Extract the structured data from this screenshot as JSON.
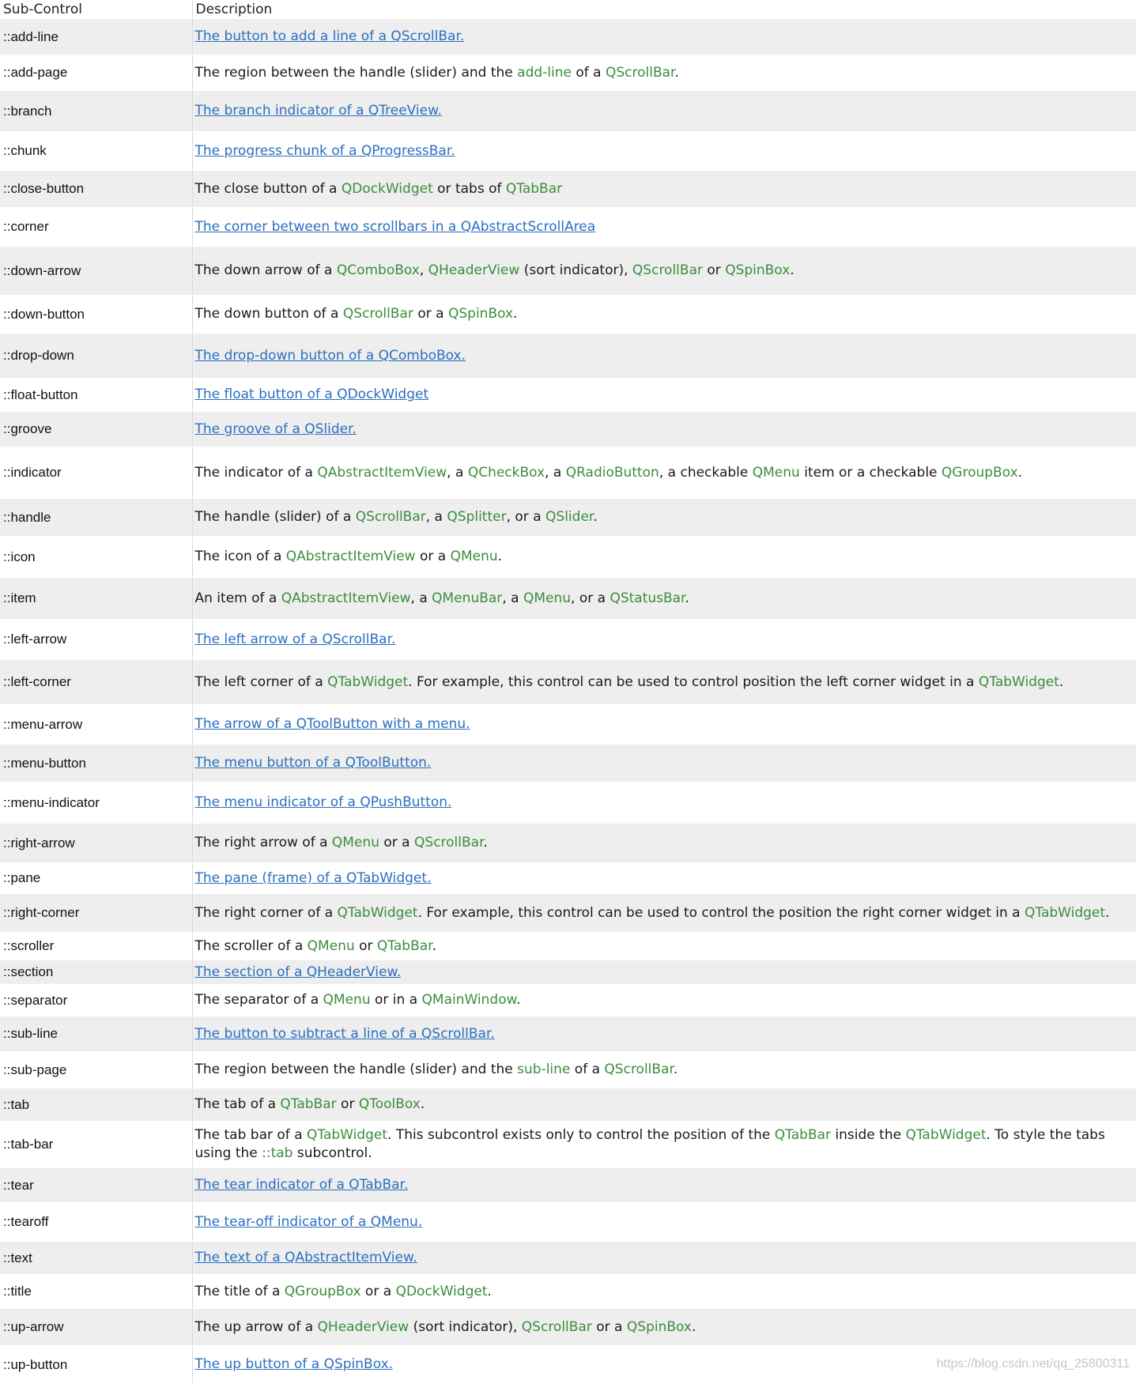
{
  "header": {
    "col1": "Sub-Control",
    "col2": "Description"
  },
  "rows": [
    {
      "name": "::add-line",
      "desc": [
        {
          "t": "The button to add a line of a QScrollBar.",
          "k": "link"
        }
      ]
    },
    {
      "name": "::add-page",
      "desc": [
        {
          "t": "The region between the handle (slider) and the ",
          "k": "text"
        },
        {
          "t": "add-line",
          "k": "ref"
        },
        {
          "t": " of a ",
          "k": "text"
        },
        {
          "t": "QScrollBar",
          "k": "ref"
        },
        {
          "t": ".",
          "k": "text"
        }
      ]
    },
    {
      "name": "::branch",
      "desc": [
        {
          "t": "The branch indicator of a QTreeView.",
          "k": "link"
        }
      ]
    },
    {
      "name": "::chunk",
      "desc": [
        {
          "t": "The progress chunk of a QProgressBar.",
          "k": "link"
        }
      ]
    },
    {
      "name": "::close-button",
      "desc": [
        {
          "t": "The close button of a ",
          "k": "text"
        },
        {
          "t": "QDockWidget",
          "k": "ref"
        },
        {
          "t": " or tabs of ",
          "k": "text"
        },
        {
          "t": "QTabBar",
          "k": "ref"
        }
      ]
    },
    {
      "name": "::corner",
      "desc": [
        {
          "t": "The corner between two scrollbars in a QAbstractScrollArea",
          "k": "link"
        }
      ]
    },
    {
      "name": "::down-arrow",
      "desc": [
        {
          "t": "The down arrow of a ",
          "k": "text"
        },
        {
          "t": "QComboBox",
          "k": "ref"
        },
        {
          "t": ", ",
          "k": "text"
        },
        {
          "t": "QHeaderView",
          "k": "ref"
        },
        {
          "t": " (sort indicator), ",
          "k": "text"
        },
        {
          "t": "QScrollBar",
          "k": "ref"
        },
        {
          "t": " or ",
          "k": "text"
        },
        {
          "t": "QSpinBox",
          "k": "ref"
        },
        {
          "t": ".",
          "k": "text"
        }
      ]
    },
    {
      "name": "::down-button",
      "desc": [
        {
          "t": "The down button of a ",
          "k": "text"
        },
        {
          "t": "QScrollBar",
          "k": "ref"
        },
        {
          "t": " or a ",
          "k": "text"
        },
        {
          "t": "QSpinBox",
          "k": "ref"
        },
        {
          "t": ".",
          "k": "text"
        }
      ]
    },
    {
      "name": "::drop-down",
      "desc": [
        {
          "t": "The drop-down button of a QComboBox.",
          "k": "link"
        }
      ]
    },
    {
      "name": "::float-button",
      "desc": [
        {
          "t": "The float button of a QDockWidget",
          "k": "link"
        }
      ]
    },
    {
      "name": "::groove",
      "desc": [
        {
          "t": "The groove of a QSlider.",
          "k": "link"
        }
      ]
    },
    {
      "name": "::indicator",
      "desc": [
        {
          "t": "The indicator of a ",
          "k": "text"
        },
        {
          "t": "QAbstractItemView",
          "k": "ref"
        },
        {
          "t": ", a ",
          "k": "text"
        },
        {
          "t": "QCheckBox",
          "k": "ref"
        },
        {
          "t": ", a ",
          "k": "text"
        },
        {
          "t": "QRadioButton",
          "k": "ref"
        },
        {
          "t": ", a checkable ",
          "k": "text"
        },
        {
          "t": "QMenu",
          "k": "ref"
        },
        {
          "t": " item or a checkable ",
          "k": "text"
        },
        {
          "t": "QGroupBox",
          "k": "ref"
        },
        {
          "t": ".",
          "k": "text"
        }
      ]
    },
    {
      "name": "::handle",
      "desc": [
        {
          "t": "The handle (slider) of a ",
          "k": "text"
        },
        {
          "t": "QScrollBar",
          "k": "ref"
        },
        {
          "t": ", a ",
          "k": "text"
        },
        {
          "t": "QSplitter",
          "k": "ref"
        },
        {
          "t": ", or a ",
          "k": "text"
        },
        {
          "t": "QSlider",
          "k": "ref"
        },
        {
          "t": ".",
          "k": "text"
        }
      ]
    },
    {
      "name": "::icon",
      "desc": [
        {
          "t": "The icon of a ",
          "k": "text"
        },
        {
          "t": "QAbstractItemView",
          "k": "ref"
        },
        {
          "t": " or a ",
          "k": "text"
        },
        {
          "t": "QMenu",
          "k": "ref"
        },
        {
          "t": ".",
          "k": "text"
        }
      ]
    },
    {
      "name": "::item",
      "desc": [
        {
          "t": "An item of a ",
          "k": "text"
        },
        {
          "t": "QAbstractItemView",
          "k": "ref"
        },
        {
          "t": ", a ",
          "k": "text"
        },
        {
          "t": "QMenuBar",
          "k": "ref"
        },
        {
          "t": ", a ",
          "k": "text"
        },
        {
          "t": "QMenu",
          "k": "ref"
        },
        {
          "t": ", or a ",
          "k": "text"
        },
        {
          "t": "QStatusBar",
          "k": "ref"
        },
        {
          "t": ".",
          "k": "text"
        }
      ]
    },
    {
      "name": "::left-arrow",
      "desc": [
        {
          "t": "The left arrow of a QScrollBar.",
          "k": "link"
        }
      ]
    },
    {
      "name": "::left-corner",
      "desc": [
        {
          "t": "The left corner of a ",
          "k": "text"
        },
        {
          "t": "QTabWidget",
          "k": "ref"
        },
        {
          "t": ". For example, this control can be used to control position the left corner widget in a ",
          "k": "text"
        },
        {
          "t": "QTabWidget",
          "k": "ref"
        },
        {
          "t": ".",
          "k": "text"
        }
      ]
    },
    {
      "name": "::menu-arrow",
      "desc": [
        {
          "t": "The arrow of a QToolButton with a menu.",
          "k": "link"
        }
      ]
    },
    {
      "name": "::menu-button",
      "desc": [
        {
          "t": "The menu button of a QToolButton.",
          "k": "link"
        }
      ]
    },
    {
      "name": "::menu-indicator",
      "desc": [
        {
          "t": "The menu indicator of a QPushButton.",
          "k": "link"
        }
      ]
    },
    {
      "name": "::right-arrow",
      "desc": [
        {
          "t": "The right arrow of a ",
          "k": "text"
        },
        {
          "t": "QMenu",
          "k": "ref"
        },
        {
          "t": " or a ",
          "k": "text"
        },
        {
          "t": "QScrollBar",
          "k": "ref"
        },
        {
          "t": ".",
          "k": "text"
        }
      ]
    },
    {
      "name": "::pane",
      "desc": [
        {
          "t": "The pane (frame) of a QTabWidget.",
          "k": "link"
        }
      ]
    },
    {
      "name": "::right-corner",
      "desc": [
        {
          "t": "The right corner of a ",
          "k": "text"
        },
        {
          "t": "QTabWidget",
          "k": "ref"
        },
        {
          "t": ". For example, this control can be used to control the position the right corner widget in a ",
          "k": "text"
        },
        {
          "t": "QTabWidget",
          "k": "ref"
        },
        {
          "t": ".",
          "k": "text"
        }
      ]
    },
    {
      "name": "::scroller",
      "desc": [
        {
          "t": "The scroller of a ",
          "k": "text"
        },
        {
          "t": "QMenu",
          "k": "ref"
        },
        {
          "t": " or ",
          "k": "text"
        },
        {
          "t": "QTabBar",
          "k": "ref"
        },
        {
          "t": ".",
          "k": "text"
        }
      ]
    },
    {
      "name": "::section",
      "desc": [
        {
          "t": "The section of a QHeaderView.",
          "k": "link"
        }
      ]
    },
    {
      "name": "::separator",
      "desc": [
        {
          "t": "The separator of a ",
          "k": "text"
        },
        {
          "t": "QMenu",
          "k": "ref"
        },
        {
          "t": " or in a ",
          "k": "text"
        },
        {
          "t": "QMainWindow",
          "k": "ref"
        },
        {
          "t": ".",
          "k": "text"
        }
      ]
    },
    {
      "name": "::sub-line",
      "desc": [
        {
          "t": "The button to subtract a line of a QScrollBar.",
          "k": "link"
        }
      ]
    },
    {
      "name": "::sub-page",
      "desc": [
        {
          "t": "The region between the handle (slider) and the ",
          "k": "text"
        },
        {
          "t": "sub-line",
          "k": "ref"
        },
        {
          "t": " of a ",
          "k": "text"
        },
        {
          "t": "QScrollBar",
          "k": "ref"
        },
        {
          "t": ".",
          "k": "text"
        }
      ]
    },
    {
      "name": "::tab",
      "desc": [
        {
          "t": "The tab of a ",
          "k": "text"
        },
        {
          "t": "QTabBar",
          "k": "ref"
        },
        {
          "t": " or ",
          "k": "text"
        },
        {
          "t": "QToolBox",
          "k": "ref"
        },
        {
          "t": ".",
          "k": "text"
        }
      ]
    },
    {
      "name": "::tab-bar",
      "desc": [
        {
          "t": "The tab bar of a ",
          "k": "text"
        },
        {
          "t": "QTabWidget",
          "k": "ref"
        },
        {
          "t": ". This subcontrol exists only to control the position of the ",
          "k": "text"
        },
        {
          "t": "QTabBar",
          "k": "ref"
        },
        {
          "t": " inside the ",
          "k": "text"
        },
        {
          "t": "QTabWidget",
          "k": "ref"
        },
        {
          "t": ". To style the tabs using the ",
          "k": "text"
        },
        {
          "t": "::tab",
          "k": "ref"
        },
        {
          "t": " subcontrol.",
          "k": "text"
        }
      ]
    },
    {
      "name": "::tear",
      "desc": [
        {
          "t": "The tear indicator of a QTabBar.",
          "k": "link"
        }
      ]
    },
    {
      "name": "::tearoff",
      "desc": [
        {
          "t": "The tear-off indicator of a QMenu.",
          "k": "link"
        }
      ]
    },
    {
      "name": "::text",
      "desc": [
        {
          "t": "The text of a QAbstractItemView.",
          "k": "link"
        }
      ]
    },
    {
      "name": "::title",
      "desc": [
        {
          "t": "The title of a ",
          "k": "text"
        },
        {
          "t": "QGroupBox",
          "k": "ref"
        },
        {
          "t": " or a ",
          "k": "text"
        },
        {
          "t": "QDockWidget",
          "k": "ref"
        },
        {
          "t": ".",
          "k": "text"
        }
      ]
    },
    {
      "name": "::up-arrow",
      "desc": [
        {
          "t": "The up arrow of a ",
          "k": "text"
        },
        {
          "t": "QHeaderView",
          "k": "ref"
        },
        {
          "t": " (sort indicator), ",
          "k": "text"
        },
        {
          "t": "QScrollBar",
          "k": "ref"
        },
        {
          "t": " or a ",
          "k": "text"
        },
        {
          "t": "QSpinBox",
          "k": "ref"
        },
        {
          "t": ".",
          "k": "text"
        }
      ]
    },
    {
      "name": "::up-button",
      "desc": [
        {
          "t": "The up button of a QSpinBox.",
          "k": "link"
        }
      ]
    }
  ],
  "watermark": "https://blog.csdn.net/qq_25800311",
  "colors": {
    "link": "#2b6fbf",
    "ref": "#3b8d3b",
    "stripe": "#eeeeee"
  }
}
